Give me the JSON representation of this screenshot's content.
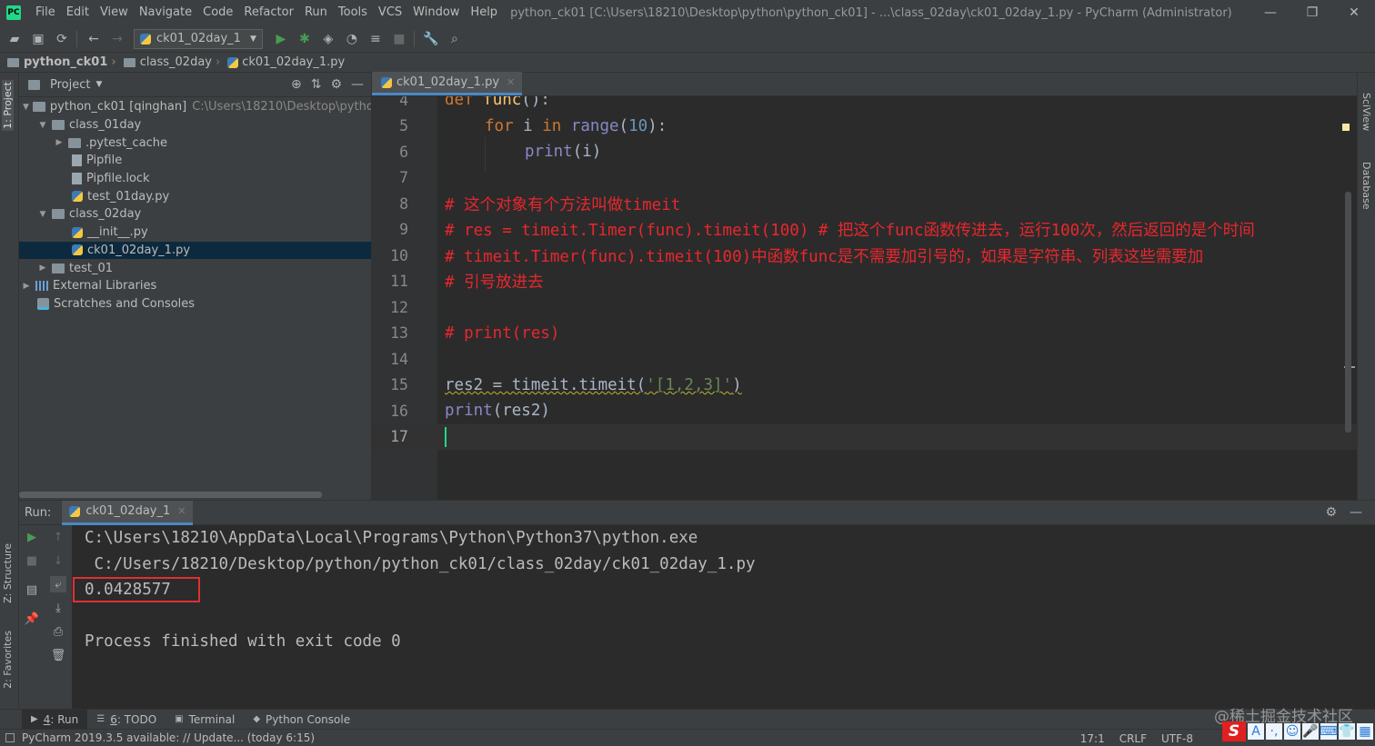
{
  "window": {
    "title": "python_ck01 [C:\\Users\\18210\\Desktop\\python\\python_ck01] - ...\\class_02day\\ck01_02day_1.py - PyCharm (Administrator)",
    "menu": [
      "File",
      "Edit",
      "View",
      "Navigate",
      "Code",
      "Refactor",
      "Run",
      "Tools",
      "VCS",
      "Window",
      "Help"
    ],
    "controls": {
      "minimize": "—",
      "restore": "❐",
      "close": "✕"
    }
  },
  "toolbar": {
    "run_config": "ck01_02day_1"
  },
  "breadcrumb": [
    "python_ck01",
    "class_02day",
    "ck01_02day_1.py"
  ],
  "left_strip": {
    "project_tab": "1: Project",
    "structure_tab": "Z: Structure",
    "favorites_tab": "2: Favorites"
  },
  "right_strip": {
    "sciview_tab": "SciView",
    "database_tab": "Database"
  },
  "project": {
    "title": "Project",
    "root": {
      "name": "python_ck01 [qinghan]",
      "path": "C:\\Users\\18210\\Desktop\\python\\python_ck01"
    },
    "items": [
      {
        "label": "class_01day",
        "type": "folder"
      },
      {
        "label": ".pytest_cache",
        "type": "folder"
      },
      {
        "label": "Pipfile",
        "type": "file"
      },
      {
        "label": "Pipfile.lock",
        "type": "file"
      },
      {
        "label": "test_01day.py",
        "type": "py"
      },
      {
        "label": "class_02day",
        "type": "folder"
      },
      {
        "label": "__init__.py",
        "type": "py"
      },
      {
        "label": "ck01_02day_1.py",
        "type": "py"
      },
      {
        "label": "test_01",
        "type": "folder"
      },
      {
        "label": "External Libraries",
        "type": "lib"
      },
      {
        "label": "Scratches and Consoles",
        "type": "scratch"
      }
    ]
  },
  "editor": {
    "tab": "ck01_02day_1.py",
    "line_numbers": [
      "4",
      "5",
      "6",
      "7",
      "8",
      "9",
      "10",
      "11",
      "12",
      "13",
      "14",
      "15",
      "16",
      "17"
    ],
    "current_line": "17",
    "code": {
      "l4_kw": "def ",
      "l4_fn": "func",
      "l4_rest": "():",
      "l5_kw": "for ",
      "l5_var": "i ",
      "l5_kw2": "in ",
      "l5_bi": "range",
      "l5_p1": "(",
      "l5_num": "10",
      "l5_p2": "):",
      "l6_bi": "print",
      "l6_rest": "(i)",
      "l8": "# 这个对象有个方法叫做timeit",
      "l9": "# res = timeit.Timer(func).timeit(100) # 把这个func函数传进去，运行100次，然后返回的是个时间",
      "l10": "# timeit.Timer(func).timeit(100)中函数func是不需要加引号的，如果是字符串、列表这些需要加",
      "l11": "# 引号放进去",
      "l13": "# print(res)",
      "l15_a": "res2 = timeit.timeit(",
      "l15_str": "'[1,2,3]'",
      "l15_b": ")",
      "l16_bi": "print",
      "l16_rest": "(res2)"
    }
  },
  "run": {
    "label": "Run:",
    "tab": "ck01_02day_1",
    "output": [
      "C:\\Users\\18210\\AppData\\Local\\Programs\\Python\\Python37\\python.exe",
      " C:/Users/18210/Desktop/python/python_ck01/class_02day/ck01_02day_1.py",
      "0.0428577",
      "",
      "Process finished with exit code 0"
    ]
  },
  "bottom_tabs": [
    {
      "num": "4",
      "label": ": Run"
    },
    {
      "num": "6",
      "label": ": TODO"
    },
    {
      "label": "Terminal"
    },
    {
      "label": "Python Console"
    }
  ],
  "status": {
    "message": "PyCharm 2019.3.5 available: // Update... (today 6:15)",
    "position": "17:1",
    "line_sep": "CRLF",
    "encoding": "UTF-8"
  },
  "watermark": "@稀土掘金技术社区",
  "ime": {
    "brand": "S",
    "icons": [
      "A",
      "·,",
      "☺",
      "🎤",
      "⌨",
      "👕",
      "▦"
    ]
  }
}
